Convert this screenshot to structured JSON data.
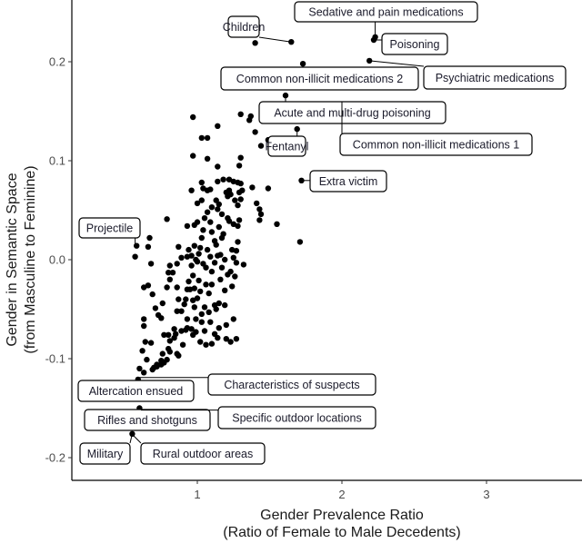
{
  "chart_data": {
    "type": "scatter",
    "title": "",
    "xlabel": "Gender Prevalence Ratio",
    "xlabel_sub": "(Ratio of Female to Male Decedents)",
    "ylabel": "Gender in Semantic Space",
    "ylabel_sub": "(from Masculine to Feminine)",
    "xlim": [
      0.13,
      3.66
    ],
    "ylim": [
      -0.21,
      0.262
    ],
    "xticks": [
      1,
      2,
      3
    ],
    "xtick_labels": [
      "1",
      "2",
      "3"
    ],
    "yticks": [
      0.2,
      0.1,
      0.0,
      -0.1,
      -0.2
    ],
    "ytick_labels": [
      "0.2",
      "0.1",
      "0.0",
      "-0.1",
      "-0.2"
    ],
    "grid": false,
    "legend": "none",
    "labeled_points": [
      {
        "label": "Children",
        "x": 1.65,
        "y": 0.22
      },
      {
        "label": "Sedative and pain medications",
        "x": 2.23,
        "y": 0.225
      },
      {
        "label": "Poisoning",
        "x": 2.22,
        "y": 0.222
      },
      {
        "label": "Common non-illicit medications 2",
        "x": 1.73,
        "y": 0.198
      },
      {
        "label": "Psychiatric medications",
        "x": 2.19,
        "y": 0.201
      },
      {
        "label": "Acute and multi-drug poisoning",
        "x": 1.61,
        "y": 0.166
      },
      {
        "label": "Fentanyl",
        "x": 1.69,
        "y": 0.132
      },
      {
        "label": "Common non-illicit medications 1",
        "x": 2.0,
        "y": 0.16
      },
      {
        "label": "Extra victim",
        "x": 1.72,
        "y": 0.08
      },
      {
        "label": "Projectile",
        "x": 0.57,
        "y": 0.015
      },
      {
        "label": "Altercation ensued",
        "x": 0.59,
        "y": -0.122
      },
      {
        "label": "Characteristics of suspects",
        "x": 0.6,
        "y": -0.119
      },
      {
        "label": "Rifles and shotguns",
        "x": 0.6,
        "y": -0.15
      },
      {
        "label": "Specific outdoor locations",
        "x": 0.61,
        "y": -0.152
      },
      {
        "label": "Military",
        "x": 0.55,
        "y": -0.176
      },
      {
        "label": "Rural outdoor areas",
        "x": 0.56,
        "y": -0.178
      }
    ],
    "points": [
      [
        1.4,
        0.219
      ],
      [
        1.65,
        0.22
      ],
      [
        1.73,
        0.198
      ],
      [
        2.19,
        0.201
      ],
      [
        2.23,
        0.225
      ],
      [
        2.22,
        0.222
      ],
      [
        1.61,
        0.166
      ],
      [
        1.69,
        0.132
      ],
      [
        1.72,
        0.08
      ],
      [
        1.55,
        0.11
      ],
      [
        1.49,
        0.121
      ],
      [
        1.56,
        0.112
      ],
      [
        0.97,
        0.144
      ],
      [
        1.14,
        0.135
      ],
      [
        1.3,
        0.147
      ],
      [
        1.36,
        0.141
      ],
      [
        1.37,
        0.145
      ],
      [
        1.4,
        0.129
      ],
      [
        1.03,
        0.123
      ],
      [
        1.07,
        0.123
      ],
      [
        0.97,
        0.105
      ],
      [
        1.07,
        0.102
      ],
      [
        1.14,
        0.094
      ],
      [
        1.3,
        0.103
      ],
      [
        1.29,
        0.095
      ],
      [
        1.44,
        0.115
      ],
      [
        1.03,
        0.078
      ],
      [
        0.96,
        0.07
      ],
      [
        1.04,
        0.072
      ],
      [
        1.07,
        0.07
      ],
      [
        1.09,
        0.071
      ],
      [
        1.14,
        0.079
      ],
      [
        1.18,
        0.081
      ],
      [
        1.22,
        0.081
      ],
      [
        1.25,
        0.079
      ],
      [
        1.28,
        0.078
      ],
      [
        1.3,
        0.077
      ],
      [
        1.31,
        0.07
      ],
      [
        1.29,
        0.068
      ],
      [
        1.23,
        0.066
      ],
      [
        1.22,
        0.07
      ],
      [
        1.2,
        0.068
      ],
      [
        1.38,
        0.073
      ],
      [
        1.21,
        0.064
      ],
      [
        1.26,
        0.06
      ],
      [
        1.3,
        0.061
      ],
      [
        1.28,
        0.055
      ],
      [
        1.41,
        0.057
      ],
      [
        1.43,
        0.051
      ],
      [
        1.44,
        0.046
      ],
      [
        1.49,
        0.072
      ],
      [
        1.15,
        0.056
      ],
      [
        1.13,
        0.06
      ],
      [
        1.14,
        0.051
      ],
      [
        1.17,
        0.046
      ],
      [
        1.21,
        0.042
      ],
      [
        1.22,
        0.039
      ],
      [
        1.25,
        0.036
      ],
      [
        1.28,
        0.034
      ],
      [
        1.29,
        0.04
      ],
      [
        1.15,
        0.033
      ],
      [
        1.55,
        0.036
      ],
      [
        1.43,
        0.04
      ],
      [
        1.18,
        0.026
      ],
      [
        1.28,
        0.018
      ],
      [
        1.27,
        0.009
      ],
      [
        1.12,
        0.019
      ],
      [
        1.13,
        0.015
      ],
      [
        1.16,
        0.005
      ],
      [
        1.71,
        0.018
      ],
      [
        1.09,
        0.038
      ],
      [
        1.05,
        0.042
      ],
      [
        1.0,
        0.038
      ],
      [
        0.98,
        0.035
      ],
      [
        0.93,
        0.034
      ],
      [
        1.04,
        0.03
      ],
      [
        1.1,
        0.028
      ],
      [
        1.03,
        0.022
      ],
      [
        0.98,
        0.014
      ],
      [
        1.02,
        0.012
      ],
      [
        1.07,
        0.01
      ],
      [
        0.94,
        0.01
      ],
      [
        0.96,
        0.004
      ],
      [
        1.01,
        0.006
      ],
      [
        1.09,
        0.003
      ],
      [
        1.12,
        -0.003
      ],
      [
        1.04,
        -0.004
      ],
      [
        0.99,
        0.0
      ],
      [
        0.96,
        -0.006
      ],
      [
        1.06,
        -0.008
      ],
      [
        1.1,
        -0.012
      ],
      [
        1.17,
        -0.008
      ],
      [
        1.21,
        -0.015
      ],
      [
        1.26,
        -0.017
      ],
      [
        1.23,
        -0.012
      ],
      [
        0.58,
        0.014
      ],
      [
        0.67,
        0.022
      ],
      [
        0.66,
        0.013
      ],
      [
        0.57,
        0.003
      ],
      [
        0.68,
        -0.004
      ],
      [
        0.79,
        0.041
      ],
      [
        0.87,
        0.013
      ],
      [
        0.8,
        -0.013
      ],
      [
        0.81,
        -0.02
      ],
      [
        0.93,
        0.003
      ],
      [
        1.0,
        -0.002
      ],
      [
        0.81,
        -0.006
      ],
      [
        0.86,
        -0.004
      ],
      [
        0.89,
        0.002
      ],
      [
        0.83,
        -0.013
      ],
      [
        0.97,
        -0.016
      ],
      [
        1.01,
        -0.021
      ],
      [
        1.06,
        -0.025
      ],
      [
        1.08,
        -0.034
      ],
      [
        1.1,
        -0.025
      ],
      [
        1.02,
        -0.032
      ],
      [
        1.0,
        -0.039
      ],
      [
        0.93,
        -0.03
      ],
      [
        0.87,
        -0.04
      ],
      [
        0.91,
        -0.045
      ],
      [
        1.05,
        -0.048
      ],
      [
        1.12,
        -0.046
      ],
      [
        1.15,
        -0.044
      ],
      [
        1.03,
        -0.055
      ],
      [
        1.08,
        -0.053
      ],
      [
        0.98,
        -0.048
      ],
      [
        0.89,
        -0.052
      ],
      [
        0.63,
        -0.028
      ],
      [
        0.66,
        -0.026
      ],
      [
        0.79,
        -0.028
      ],
      [
        0.69,
        -0.035
      ],
      [
        0.86,
        -0.028
      ],
      [
        0.94,
        -0.022
      ],
      [
        0.98,
        -0.029
      ],
      [
        0.76,
        -0.044
      ],
      [
        0.71,
        -0.049
      ],
      [
        0.73,
        -0.056
      ],
      [
        0.86,
        -0.052
      ],
      [
        0.93,
        -0.06
      ],
      [
        0.99,
        -0.06
      ],
      [
        1.03,
        -0.063
      ],
      [
        1.09,
        -0.063
      ],
      [
        0.84,
        -0.07
      ],
      [
        0.89,
        -0.072
      ],
      [
        0.96,
        -0.07
      ],
      [
        1.05,
        -0.072
      ],
      [
        1.12,
        -0.075
      ],
      [
        1.15,
        -0.069
      ],
      [
        0.99,
        -0.073
      ],
      [
        0.63,
        -0.06
      ],
      [
        0.63,
        -0.067
      ],
      [
        0.75,
        -0.059
      ],
      [
        0.85,
        -0.075
      ],
      [
        0.92,
        -0.071
      ],
      [
        0.9,
        -0.086
      ],
      [
        0.8,
        -0.076
      ],
      [
        0.8,
        -0.09
      ],
      [
        0.81,
        -0.082
      ],
      [
        0.77,
        -0.076
      ],
      [
        0.64,
        -0.083
      ],
      [
        0.68,
        -0.084
      ],
      [
        0.84,
        -0.079
      ],
      [
        0.93,
        -0.069
      ],
      [
        0.76,
        -0.095
      ],
      [
        0.81,
        -0.093
      ],
      [
        0.86,
        -0.095
      ],
      [
        0.97,
        -0.076
      ],
      [
        1.13,
        -0.05
      ],
      [
        1.19,
        -0.046
      ],
      [
        0.62,
        -0.092
      ],
      [
        0.65,
        -0.101
      ],
      [
        0.6,
        -0.11
      ],
      [
        0.63,
        -0.114
      ],
      [
        0.69,
        -0.111
      ],
      [
        0.75,
        -0.106
      ],
      [
        0.77,
        -0.104
      ],
      [
        0.79,
        -0.101
      ],
      [
        0.72,
        -0.106
      ],
      [
        0.7,
        -0.109
      ],
      [
        0.72,
        -0.108
      ],
      [
        0.75,
        -0.102
      ],
      [
        0.87,
        -0.097
      ],
      [
        1.02,
        -0.083
      ],
      [
        1.06,
        -0.086
      ],
      [
        1.1,
        -0.085
      ],
      [
        1.14,
        -0.079
      ],
      [
        1.2,
        -0.08
      ],
      [
        1.23,
        -0.083
      ],
      [
        1.27,
        -0.08
      ],
      [
        1.2,
        -0.066
      ],
      [
        1.25,
        -0.06
      ],
      [
        1.16,
        -0.02
      ],
      [
        1.19,
        -0.031
      ],
      [
        1.24,
        -0.027
      ],
      [
        1.19,
        0.0
      ],
      [
        1.14,
        0.004
      ],
      [
        1.27,
        -0.003
      ],
      [
        1.32,
        -0.005
      ],
      [
        1.24,
        0.01
      ],
      [
        0.97,
        -0.041
      ],
      [
        0.92,
        -0.04
      ],
      [
        0.95,
        -0.03
      ],
      [
        1.17,
        0.022
      ],
      [
        1.07,
        0.048
      ],
      [
        1.1,
        0.053
      ],
      [
        1.0,
        0.057
      ],
      [
        1.03,
        0.06
      ],
      [
        1.25,
        0.002
      ],
      [
        0.59,
        -0.121
      ],
      [
        0.6,
        -0.15
      ],
      [
        0.55,
        -0.176
      ]
    ]
  }
}
